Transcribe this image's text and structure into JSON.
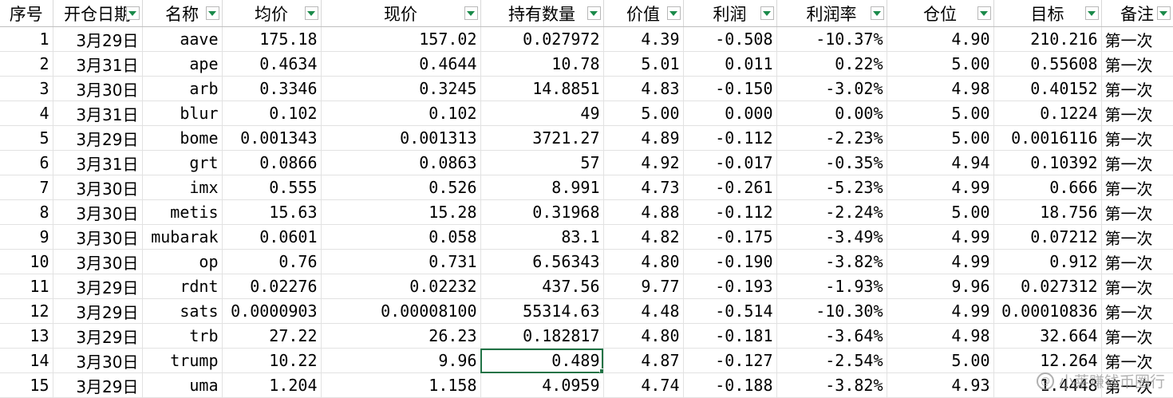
{
  "columns": [
    {
      "label": "序号",
      "filter": false
    },
    {
      "label": "开仓日期",
      "filter": true
    },
    {
      "label": "名称",
      "filter": true
    },
    {
      "label": "均价",
      "filter": true
    },
    {
      "label": "现价",
      "filter": true
    },
    {
      "label": "持有数量",
      "filter": true
    },
    {
      "label": "价值",
      "filter": true
    },
    {
      "label": "利润",
      "filter": true
    },
    {
      "label": "利润率",
      "filter": true
    },
    {
      "label": "仓位",
      "filter": true
    },
    {
      "label": "目标",
      "filter": true
    },
    {
      "label": "备注",
      "filter": true
    }
  ],
  "rows": [
    [
      "1",
      "3月29日",
      "aave",
      "175.18",
      "157.02",
      "0.027972",
      "4.39",
      "-0.508",
      "-10.37%",
      "4.90",
      "210.216",
      "第一次"
    ],
    [
      "2",
      "3月31日",
      "ape",
      "0.4634",
      "0.4644",
      "10.78",
      "5.01",
      "0.011",
      "0.22%",
      "5.00",
      "0.55608",
      "第一次"
    ],
    [
      "3",
      "3月30日",
      "arb",
      "0.3346",
      "0.3245",
      "14.8851",
      "4.83",
      "-0.150",
      "-3.02%",
      "4.98",
      "0.40152",
      "第一次"
    ],
    [
      "4",
      "3月31日",
      "blur",
      "0.102",
      "0.102",
      "49",
      "5.00",
      "0.000",
      "0.00%",
      "5.00",
      "0.1224",
      "第一次"
    ],
    [
      "5",
      "3月29日",
      "bome",
      "0.001343",
      "0.001313",
      "3721.27",
      "4.89",
      "-0.112",
      "-2.23%",
      "5.00",
      "0.0016116",
      "第一次"
    ],
    [
      "6",
      "3月31日",
      "grt",
      "0.0866",
      "0.0863",
      "57",
      "4.92",
      "-0.017",
      "-0.35%",
      "4.94",
      "0.10392",
      "第一次"
    ],
    [
      "7",
      "3月30日",
      "imx",
      "0.555",
      "0.526",
      "8.991",
      "4.73",
      "-0.261",
      "-5.23%",
      "4.99",
      "0.666",
      "第一次"
    ],
    [
      "8",
      "3月30日",
      "metis",
      "15.63",
      "15.28",
      "0.31968",
      "4.88",
      "-0.112",
      "-2.24%",
      "5.00",
      "18.756",
      "第一次"
    ],
    [
      "9",
      "3月30日",
      "mubarak",
      "0.0601",
      "0.058",
      "83.1",
      "4.82",
      "-0.175",
      "-3.49%",
      "4.99",
      "0.07212",
      "第一次"
    ],
    [
      "10",
      "3月30日",
      "op",
      "0.76",
      "0.731",
      "6.56343",
      "4.80",
      "-0.190",
      "-3.82%",
      "4.99",
      "0.912",
      "第一次"
    ],
    [
      "11",
      "3月29日",
      "rdnt",
      "0.02276",
      "0.02232",
      "437.56",
      "9.77",
      "-0.193",
      "-1.93%",
      "9.96",
      "0.027312",
      "第一次"
    ],
    [
      "12",
      "3月29日",
      "sats",
      "0.0000903",
      "0.00008100",
      "55314.63",
      "4.48",
      "-0.514",
      "-10.30%",
      "4.99",
      "0.00010836",
      "第一次"
    ],
    [
      "13",
      "3月29日",
      "trb",
      "27.22",
      "26.23",
      "0.182817",
      "4.80",
      "-0.181",
      "-3.64%",
      "4.98",
      "32.664",
      "第一次"
    ],
    [
      "14",
      "3月30日",
      "trump",
      "10.22",
      "9.96",
      "0.489",
      "4.87",
      "-0.127",
      "-2.54%",
      "5.00",
      "12.264",
      "第一次"
    ],
    [
      "15",
      "3月29日",
      "uma",
      "1.204",
      "1.158",
      "4.0959",
      "4.74",
      "-0.188",
      "-3.82%",
      "4.93",
      "1.4448",
      "第一次"
    ]
  ],
  "selected_cell": {
    "row": 13,
    "col": 5
  },
  "watermark": {
    "text": "小莱赚钱币圈行",
    "icon": "at-icon"
  },
  "colors": {
    "filter_arrow": "#1a8a4a",
    "selection": "#217346"
  }
}
